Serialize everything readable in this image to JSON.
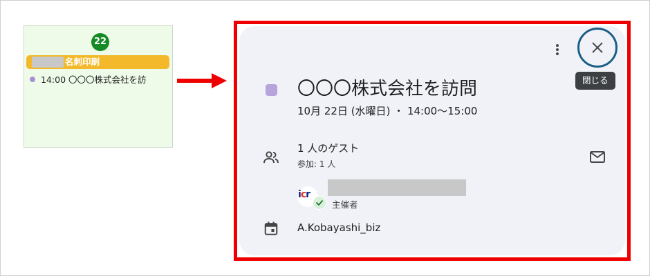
{
  "calendar_cell": {
    "day_number": "22",
    "events": [
      {
        "label": "名刺印刷",
        "color": "#f3b92b"
      },
      {
        "time": "14:00",
        "title": "〇〇〇株式会社を訪",
        "dot_color": "#a88fd3"
      }
    ]
  },
  "event_detail": {
    "title": "〇〇〇株式会社を訪問",
    "datetime": "10月 22日 (水曜日) ・ 14:00〜15:00",
    "color": "#b7a4dc",
    "guests_title": "1 人のゲスト",
    "guests_sub": "参加: 1 人",
    "organizer_label": "主催者",
    "calendar_name": "A.Kobayashi_biz",
    "close_tooltip": "閉じる"
  },
  "icons": {
    "more": "more-vert-icon",
    "close": "close-icon",
    "people": "people-icon",
    "mail": "mail-icon",
    "calendar": "calendar-icon",
    "check": "check-icon"
  },
  "colors": {
    "highlight": "#ef0000",
    "day_badge": "#168a25",
    "close_ring": "#1b5e86"
  }
}
